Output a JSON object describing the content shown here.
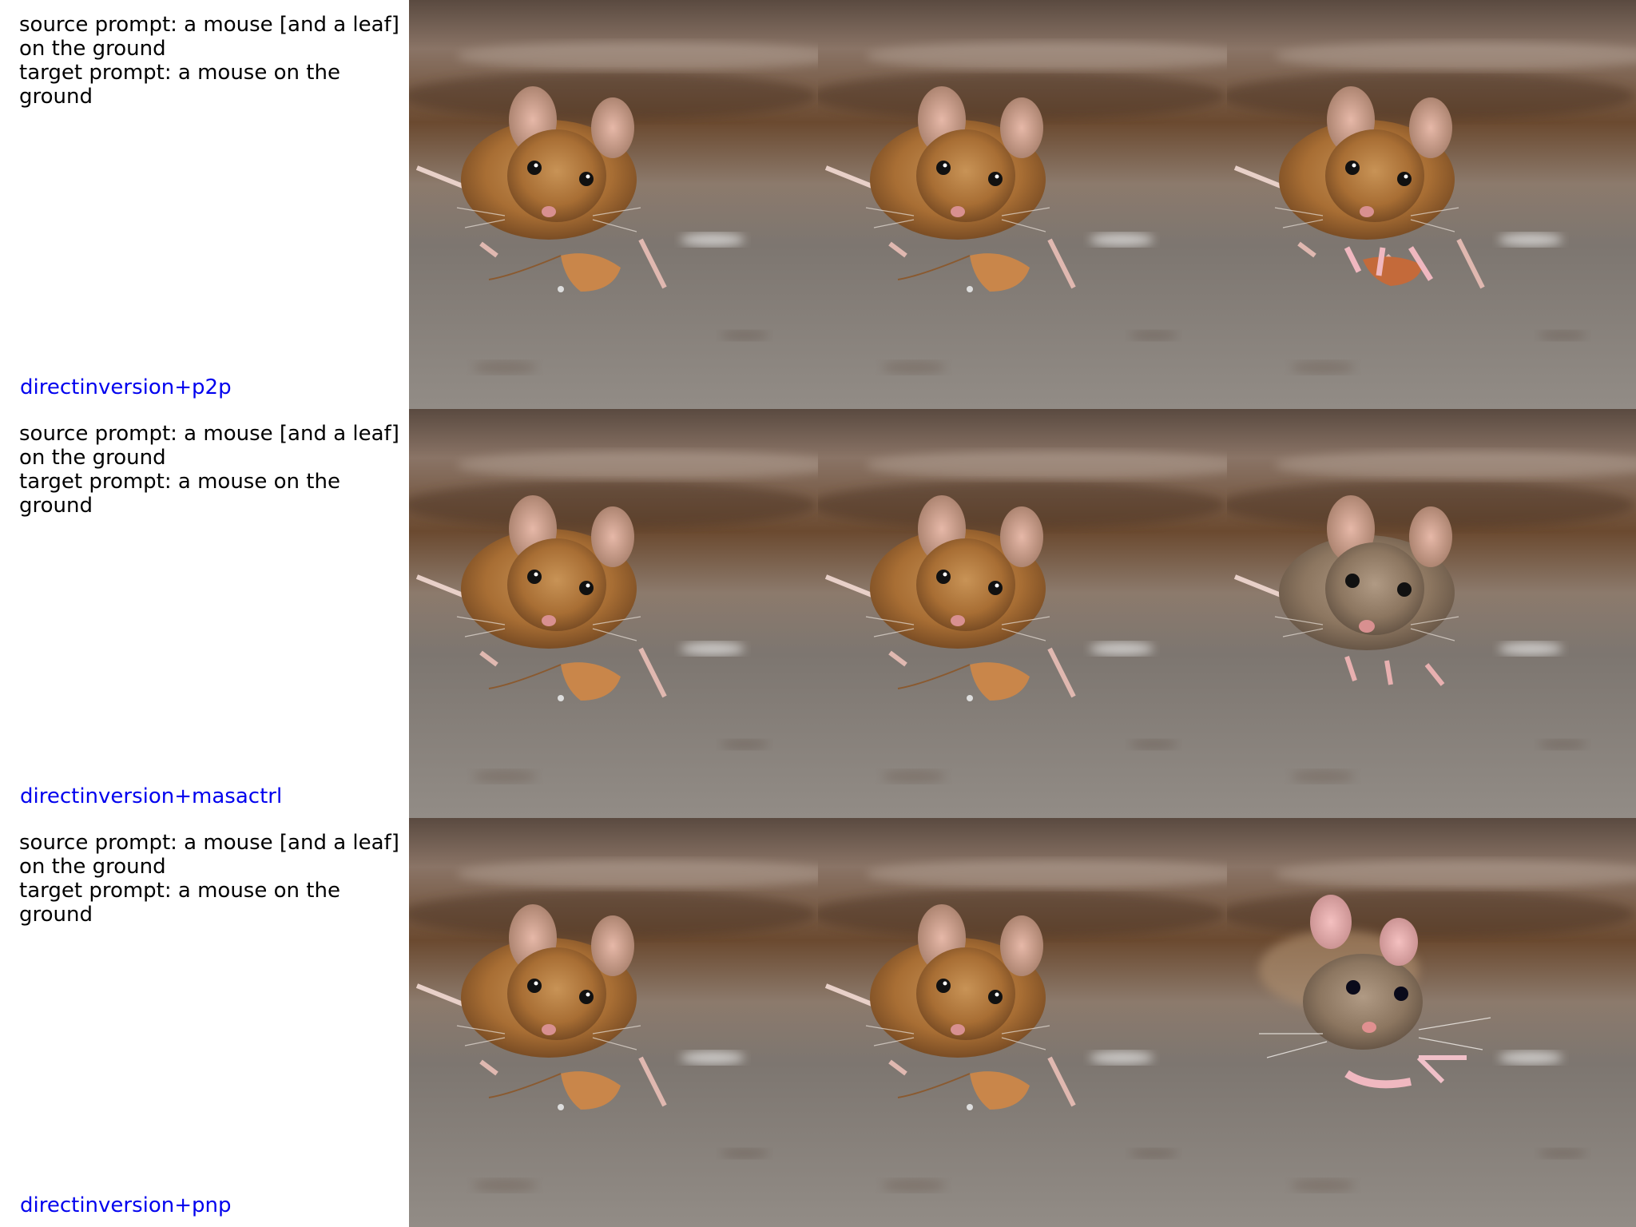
{
  "rows": [
    {
      "source_prompt": "source prompt: a mouse [and a leaf] on the ground",
      "target_prompt": "target prompt: a mouse on the ground",
      "method": "directinversion+p2p"
    },
    {
      "source_prompt": "source prompt: a mouse [and a leaf] on the ground",
      "target_prompt": "target prompt: a mouse on the ground",
      "method": "directinversion+masactrl"
    },
    {
      "source_prompt": "source prompt: a mouse [and a leaf] on the ground",
      "target_prompt": "target prompt: a mouse on the ground",
      "method": "directinversion+pnp"
    }
  ],
  "colors": {
    "method_label": "#0000ee",
    "ground": "#8a8682",
    "fur": "#b07a3e",
    "leaf": "#c9864a"
  }
}
